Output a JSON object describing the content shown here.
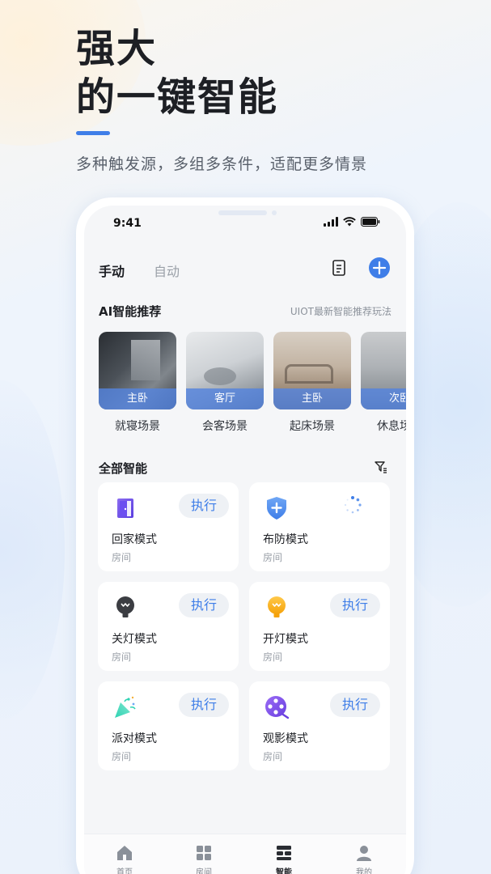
{
  "hero": {
    "title_line1": "强大",
    "title_line2": "的一键智能",
    "subtitle": "多种触发源，多组多条件，适配更多情景"
  },
  "status_bar": {
    "time": "9:41"
  },
  "header": {
    "tab_manual": "手动",
    "tab_auto": "自动"
  },
  "ai_section": {
    "title": "AI智能推荐",
    "link": "UIOT最新智能推荐玩法",
    "items": [
      {
        "room": "主卧",
        "name": "就寝场景"
      },
      {
        "room": "客厅",
        "name": "会客场景"
      },
      {
        "room": "主卧",
        "name": "起床场景"
      },
      {
        "room": "次卧",
        "name": "休息场景"
      }
    ]
  },
  "all_section": {
    "title": "全部智能",
    "cards": [
      {
        "title": "回家模式",
        "room": "房间",
        "exec": "执行",
        "icon": "door-icon"
      },
      {
        "title": "布防模式",
        "room": "房间",
        "exec": "",
        "icon": "shield-plus-icon"
      },
      {
        "title": "关灯模式",
        "room": "房间",
        "exec": "执行",
        "icon": "bulb-off-icon"
      },
      {
        "title": "开灯模式",
        "room": "房间",
        "exec": "执行",
        "icon": "bulb-on-icon"
      },
      {
        "title": "派对模式",
        "room": "房间",
        "exec": "执行",
        "icon": "party-popper-icon"
      },
      {
        "title": "观影模式",
        "room": "房间",
        "exec": "执行",
        "icon": "film-reel-icon"
      }
    ]
  },
  "bottom_nav": {
    "items": [
      {
        "label": "首页",
        "icon": "home-icon"
      },
      {
        "label": "房间",
        "icon": "grid-icon"
      },
      {
        "label": "智能",
        "icon": "smart-icon",
        "active": true
      },
      {
        "label": "我的",
        "icon": "user-icon"
      }
    ]
  },
  "colors": {
    "accent": "#3f7ee8",
    "room_tag": "#5484de",
    "card_bg": "#ffffff",
    "screen_bg": "#f5f6f8"
  }
}
